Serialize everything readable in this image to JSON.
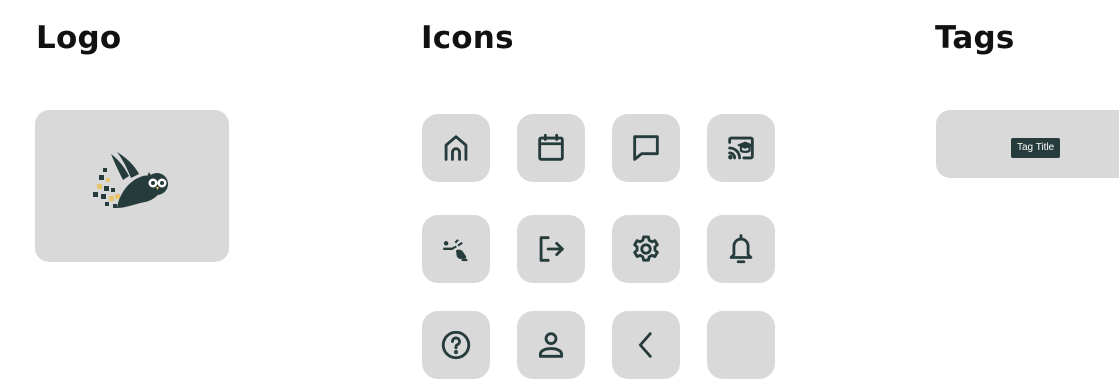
{
  "sections": {
    "logo_title": "Logo",
    "icons_title": "Icons",
    "tags_title": "Tags"
  },
  "logo": {
    "icon": "owl-logo-icon"
  },
  "icons": [
    "home-icon",
    "calendar-icon",
    "message-icon",
    "cast-education-icon",
    "sign-language-icon",
    "logout-icon",
    "gear-icon",
    "bell-icon",
    "help-icon",
    "user-icon",
    "chevron-left-icon",
    "empty-icon-slot"
  ],
  "tag": {
    "label": "Tag Title"
  },
  "colors": {
    "tile_bg": "#d9d9d9",
    "icon_stroke": "#263b3b",
    "tag_bg": "#263b3b",
    "accent_yellow": "#e9c46a"
  }
}
